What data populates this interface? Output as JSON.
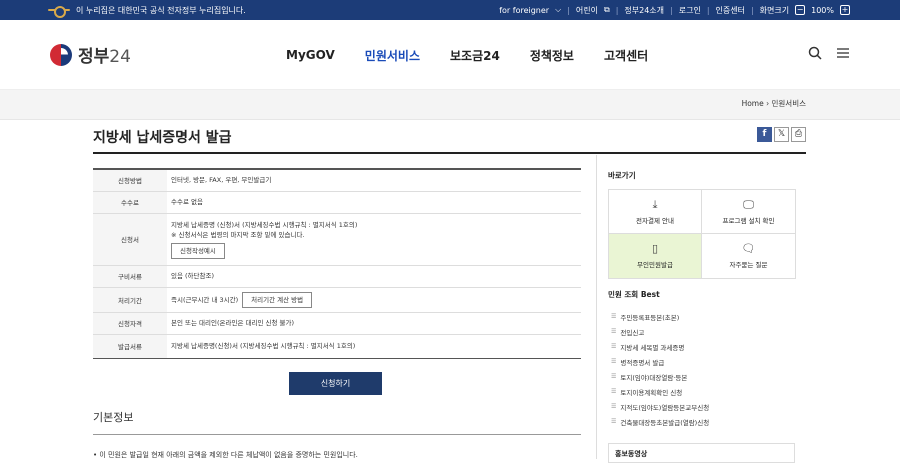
{
  "topbar": {
    "notice": "이 누리집은 대한민국 공식 전자정부 누리집입니다.",
    "foreigner": "for foreigner",
    "kids": "어린이",
    "about": "정부24소개",
    "login": "로그인",
    "cert": "인증센터",
    "zoom_label": "화면크기",
    "zoom": "100%"
  },
  "header": {
    "logo_main": "정부",
    "logo_num": "24",
    "nav": [
      "MyGOV",
      "민원서비스",
      "보조금24",
      "정책정보",
      "고객센터"
    ]
  },
  "breadcrumb": {
    "home": "Home",
    "current": "민원서비스"
  },
  "page": {
    "title": "지방세 납세증명서 발급"
  },
  "info_rows": [
    {
      "label": "신청방법",
      "value": "인터넷, 방문, FAX, 우편, 무인발급기"
    },
    {
      "label": "수수료",
      "value": "수수료 없음"
    },
    {
      "label": "신청서",
      "value": "지방세 납세증명 (신청)서 (지방세징수법 시행규칙 : 별지서식 1호의)",
      "note": "※ 신청서식은 법령의 마지막 조항 밑에 있습니다.",
      "button": "신청작성예시"
    },
    {
      "label": "구비서류",
      "value": "있음 (하단참조)"
    },
    {
      "label": "처리기간",
      "value": "즉시(근무시간 내 3시간)",
      "button": "처리기간 계산 방법"
    },
    {
      "label": "신청자격",
      "value": "본인 또는 대리인(온라인은 대리인 신청 불가)"
    },
    {
      "label": "발급서류",
      "value": "지방세 납세증명(신청)서 (지방세징수법 시행규칙 : 별지서식 1호의)"
    }
  ],
  "apply_label": "신청하기",
  "basic": {
    "title": "기본정보",
    "bullet": "이 민원은 발급일 현재 아래의 금액을 제외한 다른 체납액이 없음을 증명하는 민원입니다."
  },
  "side": {
    "quick_title": "바로가기",
    "quick": [
      {
        "label": "전자결제 안내",
        "icon": "download-icon"
      },
      {
        "label": "프로그램 설치 확인",
        "icon": "monitor-check-icon"
      },
      {
        "label": "무인민원발급",
        "icon": "kiosk-icon"
      },
      {
        "label": "자주묻는 질문",
        "icon": "chat-icon"
      }
    ],
    "best_title": "민원 조회 Best",
    "best": [
      "주민등록표등본(초본)",
      "전입신고",
      "지방세 세목별 과세증명",
      "병적증명서 발급",
      "토지(임야)대장열람·등본",
      "토지이용계획확인 신청",
      "지적도(임야도)열람등본교부신청",
      "건축물대장등초본발급(열람)신청"
    ],
    "promo": "홍보동영상"
  }
}
